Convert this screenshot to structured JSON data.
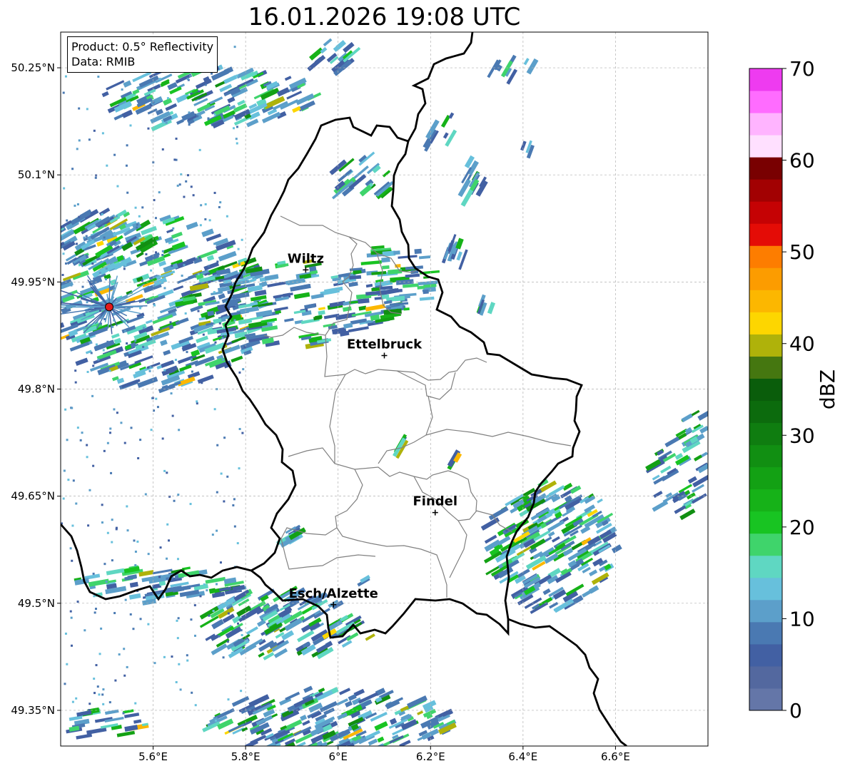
{
  "title": "16.01.2026 19:08 UTC",
  "info": {
    "product": "Product: 0.5° Reflectivity",
    "data": "Data: RMIB"
  },
  "map": {
    "lon_range": [
      5.4,
      6.8
    ],
    "lat_range": [
      49.3,
      50.3
    ],
    "x_ticks": [
      {
        "value": 5.6,
        "label": "5.6°E"
      },
      {
        "value": 5.8,
        "label": "5.8°E"
      },
      {
        "value": 6.0,
        "label": "6°E"
      },
      {
        "value": 6.2,
        "label": "6.2°E"
      },
      {
        "value": 6.4,
        "label": "6.4°E"
      },
      {
        "value": 6.6,
        "label": "6.6°E"
      }
    ],
    "y_ticks": [
      {
        "value": 50.25,
        "label": "50.25°N"
      },
      {
        "value": 50.1,
        "label": "50.1°N"
      },
      {
        "value": 49.95,
        "label": "49.95°N"
      },
      {
        "value": 49.8,
        "label": "49.8°N"
      },
      {
        "value": 49.65,
        "label": "49.65°N"
      },
      {
        "value": 49.5,
        "label": "49.5°N"
      },
      {
        "value": 49.35,
        "label": "49.35°N"
      }
    ],
    "gridlines": true,
    "cities": [
      {
        "name": "Wiltz",
        "lon": 5.93,
        "lat": 49.967
      },
      {
        "name": "Ettelbruck",
        "lon": 6.1,
        "lat": 49.847
      },
      {
        "name": "Findel",
        "lon": 6.21,
        "lat": 49.627
      },
      {
        "name": "Esch/Alzette",
        "lon": 5.99,
        "lat": 49.498
      }
    ],
    "radar_site": {
      "lon": 5.505,
      "lat": 49.915,
      "color": "#e31a1c"
    }
  },
  "colorbar": {
    "label": "dBZ",
    "range": [
      0,
      70
    ],
    "tick_values": [
      0,
      10,
      20,
      30,
      40,
      50,
      60,
      70
    ],
    "tick_labels": [
      "0",
      "10",
      "20",
      "30",
      "40",
      "50",
      "60",
      "70"
    ],
    "colors": [
      "#6476a8",
      "#53689f",
      "#4260a3",
      "#4a79b2",
      "#5c9fca",
      "#67c0dc",
      "#5fd7c2",
      "#3fd46b",
      "#18c422",
      "#16b218",
      "#13a114",
      "#118f12",
      "#0f7d10",
      "#0c6b0d",
      "#0a5d0b",
      "#457710",
      "#afb20a",
      "#fdd600",
      "#fcb700",
      "#fc9c00",
      "#fd7d00",
      "#e40c06",
      "#c50204",
      "#a20102",
      "#790001",
      "#ffe0ff",
      "#ffb4ff",
      "#ff6cff",
      "#ee3bf0"
    ]
  },
  "legend_colors": {
    "border": "#000000",
    "admin": "#808080",
    "grid": "#b0b0b0"
  }
}
